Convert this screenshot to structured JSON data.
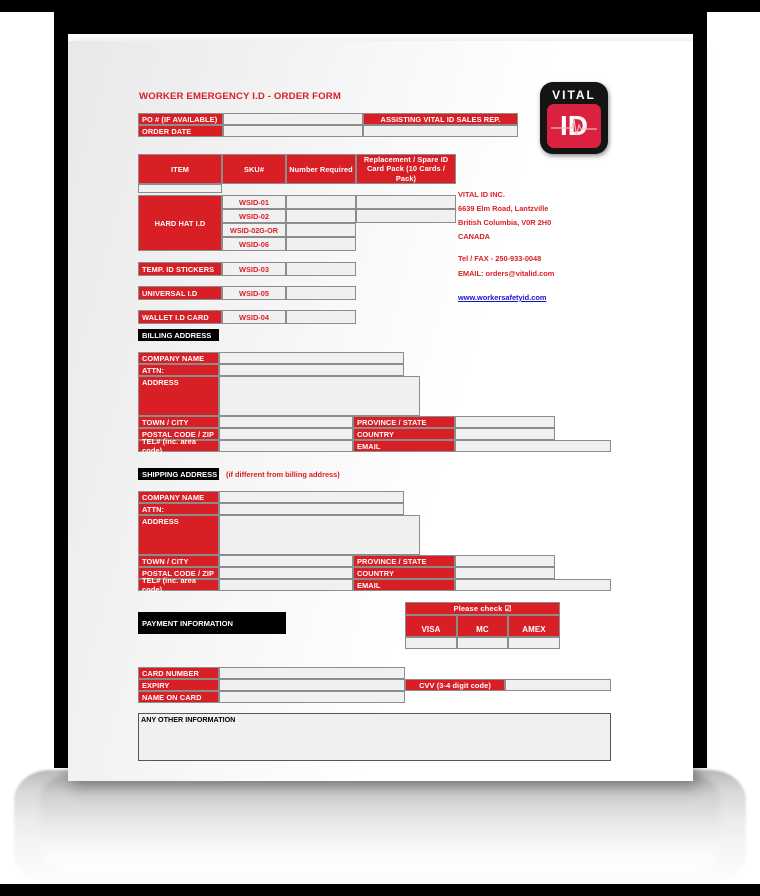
{
  "document": {
    "title": "WORKER EMERGENCY I.D - ORDER FORM"
  },
  "logo": {
    "top_text": "VITAL",
    "badge_text": "ID",
    "ekg_icon": "heartbeat-icon"
  },
  "top_fields": {
    "po_label": "PO # (IF AVAILABLE)",
    "po_value": "",
    "order_date_label": "ORDER DATE",
    "order_date_value": "",
    "sales_rep_label": "ASSISTING VITAL ID SALES REP.",
    "sales_rep_value": ""
  },
  "item_table": {
    "headers": {
      "item": "ITEM",
      "sku": "SKU#",
      "qty": "Number Required",
      "pack": "Replacement / Spare ID Card Pack (10 Cards / Pack)"
    },
    "groups": [
      {
        "name": "HARD HAT I.D",
        "rows": [
          {
            "sku": "WSID-01",
            "qty": "",
            "pack": "",
            "has_pack": true
          },
          {
            "sku": "WSID-02",
            "qty": "",
            "pack": "",
            "has_pack": true
          },
          {
            "sku": "WSID-02G-OR",
            "qty": "",
            "pack": "",
            "has_pack": false
          },
          {
            "sku": "WSID-06",
            "qty": "",
            "pack": "",
            "has_pack": false
          }
        ]
      },
      {
        "name": "TEMP. ID STICKERS",
        "rows": [
          {
            "sku": "WSID-03",
            "qty": "",
            "has_pack": false
          }
        ]
      },
      {
        "name": "UNIVERSAL I.D",
        "rows": [
          {
            "sku": "WSID-05",
            "qty": "",
            "has_pack": false
          }
        ]
      },
      {
        "name": "WALLET I.D CARD",
        "rows": [
          {
            "sku": "WSID-04",
            "qty": "",
            "has_pack": false
          }
        ]
      }
    ]
  },
  "contact": {
    "company": "VITAL ID INC.",
    "street": "6639 Elm Road, Lantzville",
    "region": "British Columbia, V0R 2H0",
    "country": "CANADA",
    "phone": "Tel / FAX - 250-933-0048",
    "email": "EMAIL: orders@vitalid.com",
    "website": "www.workersafetyid.com"
  },
  "billing": {
    "section_title": "BILLING ADDRESS",
    "labels": {
      "company_name": "COMPANY NAME",
      "attn": "ATTN:",
      "address": "ADDRESS",
      "town_city": "TOWN / CITY",
      "postal_code": "POSTAL CODE / ZIP",
      "tel": "TEL# (inc. area code)",
      "province_state": "PROVINCE / STATE",
      "country": "COUNTRY",
      "email": "EMAIL"
    },
    "values": {
      "company_name": "",
      "attn": "",
      "address": "",
      "town_city": "",
      "postal_code": "",
      "tel": "",
      "province_state": "",
      "country": "",
      "email": ""
    }
  },
  "shipping": {
    "section_title": "SHIPPING ADDRESS",
    "section_note": "(if different from billing address)",
    "labels": {
      "company_name": "COMPANY NAME",
      "attn": "ATTN:",
      "address": "ADDRESS",
      "town_city": "TOWN / CITY",
      "postal_code": "POSTAL CODE / ZIP",
      "tel": "TEL# (inc. area code)",
      "province_state": "PROVINCE / STATE",
      "country": "COUNTRY",
      "email": "EMAIL"
    },
    "values": {
      "company_name": "",
      "attn": "",
      "address": "",
      "town_city": "",
      "postal_code": "",
      "tel": "",
      "province_state": "",
      "country": "",
      "email": ""
    }
  },
  "payment": {
    "section_title": "PAYMENT INFORMATION",
    "check_header": "Please check ☑",
    "card_types": [
      "VISA",
      "MC",
      "AMEX"
    ],
    "card_checks": [
      "",
      "",
      ""
    ],
    "labels": {
      "card_number": "CARD NUMBER",
      "expiry": "EXPIRY",
      "name_on_card": "NAME ON CARD",
      "cvv": "CVV (3-4 digit code)"
    },
    "values": {
      "card_number": "",
      "expiry": "",
      "name_on_card": "",
      "cvv": ""
    }
  },
  "other": {
    "label": "ANY OTHER INFORMATION",
    "value": ""
  },
  "colors": {
    "red": "#d91f26",
    "black": "#000000",
    "field": "#f0f0f0",
    "link_blue": "#1515cf",
    "logo_red": "#da2240"
  }
}
